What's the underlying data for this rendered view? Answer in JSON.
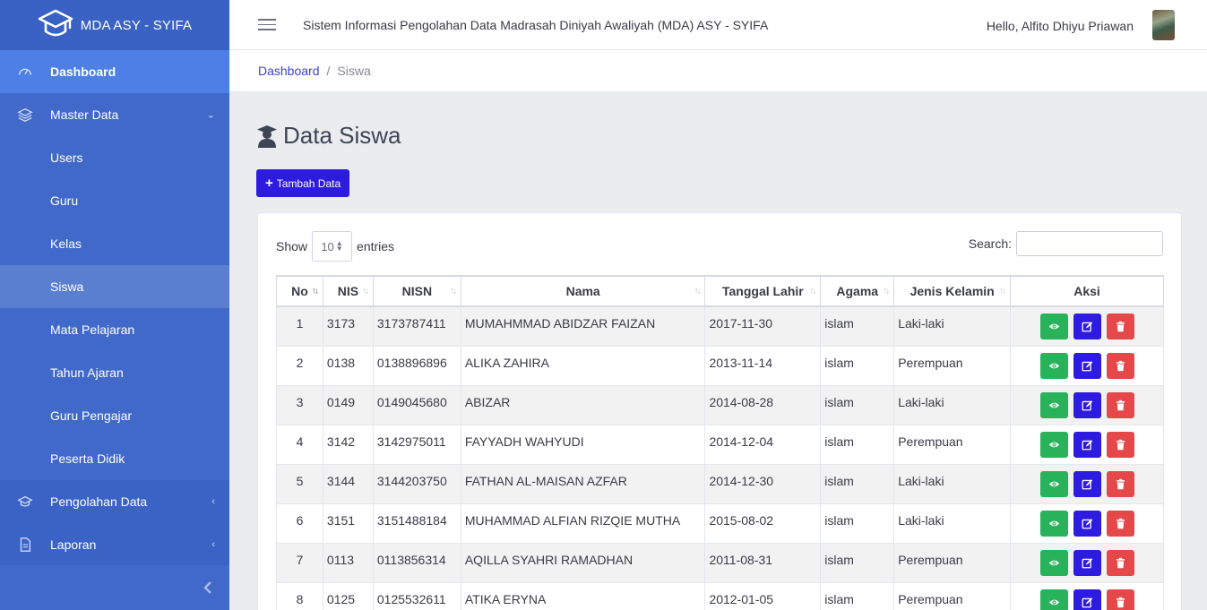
{
  "brand": {
    "title": "MDA ASY - SYIFA"
  },
  "topbar": {
    "app_title": "Sistem Informasi Pengolahan Data Madrasah Diniyah Awaliyah (MDA) ASY - SYIFA",
    "greeting": "Hello, Alfito Dhiyu Priawan"
  },
  "sidebar": {
    "dashboard": "Dashboard",
    "master_data": "Master Data",
    "items": [
      "Users",
      "Guru",
      "Kelas",
      "Siswa",
      "Mata Pelajaran",
      "Tahun Ajaran",
      "Guru Pengajar",
      "Peserta Didik"
    ],
    "pengolahan": "Pengolahan Data",
    "laporan": "Laporan"
  },
  "breadcrumb": {
    "home": "Dashboard",
    "sep": "/",
    "current": "Siswa"
  },
  "page": {
    "title": "Data Siswa",
    "add_button": "Tambah Data"
  },
  "table_controls": {
    "show": "Show",
    "length": "10",
    "entries": "entries",
    "search_label": "Search:"
  },
  "table": {
    "headers": [
      "No",
      "NIS",
      "NISN",
      "Nama",
      "Tanggal Lahir",
      "Agama",
      "Jenis Kelamin",
      "Aksi"
    ],
    "rows": [
      [
        "1",
        "3173",
        "3173787411",
        "MUMAHMMAD ABIDZAR FAIZAN",
        "2017-11-30",
        "islam",
        "Laki-laki"
      ],
      [
        "2",
        "0138",
        "0138896896",
        "ALIKA ZAHIRA",
        "2013-11-14",
        "islam",
        "Perempuan"
      ],
      [
        "3",
        "0149",
        "0149045680",
        "ABIZAR",
        "2014-08-28",
        "islam",
        "Laki-laki"
      ],
      [
        "4",
        "3142",
        "3142975011",
        "FAYYADH WAHYUDI",
        "2014-12-04",
        "islam",
        "Perempuan"
      ],
      [
        "5",
        "3144",
        "3144203750",
        "FATHAN AL-MAISAN AZFAR",
        "2014-12-30",
        "islam",
        "Laki-laki"
      ],
      [
        "6",
        "3151",
        "3151488184",
        "MUHAMMAD ALFIAN RIZQIE MUTHA",
        "2015-08-02",
        "islam",
        "Laki-laki"
      ],
      [
        "7",
        "0113",
        "0113856314",
        "AQILLA SYAHRI RAMADHAN",
        "2011-08-31",
        "islam",
        "Perempuan"
      ],
      [
        "8",
        "0125",
        "0125532611",
        "ATIKA ERYNA",
        "2012-01-05",
        "islam",
        "Perempuan"
      ]
    ]
  },
  "colors": {
    "sidebar": "#4169c9",
    "primary_button": "#2e1be0",
    "view": "#28b35a",
    "delete": "#e54848"
  }
}
